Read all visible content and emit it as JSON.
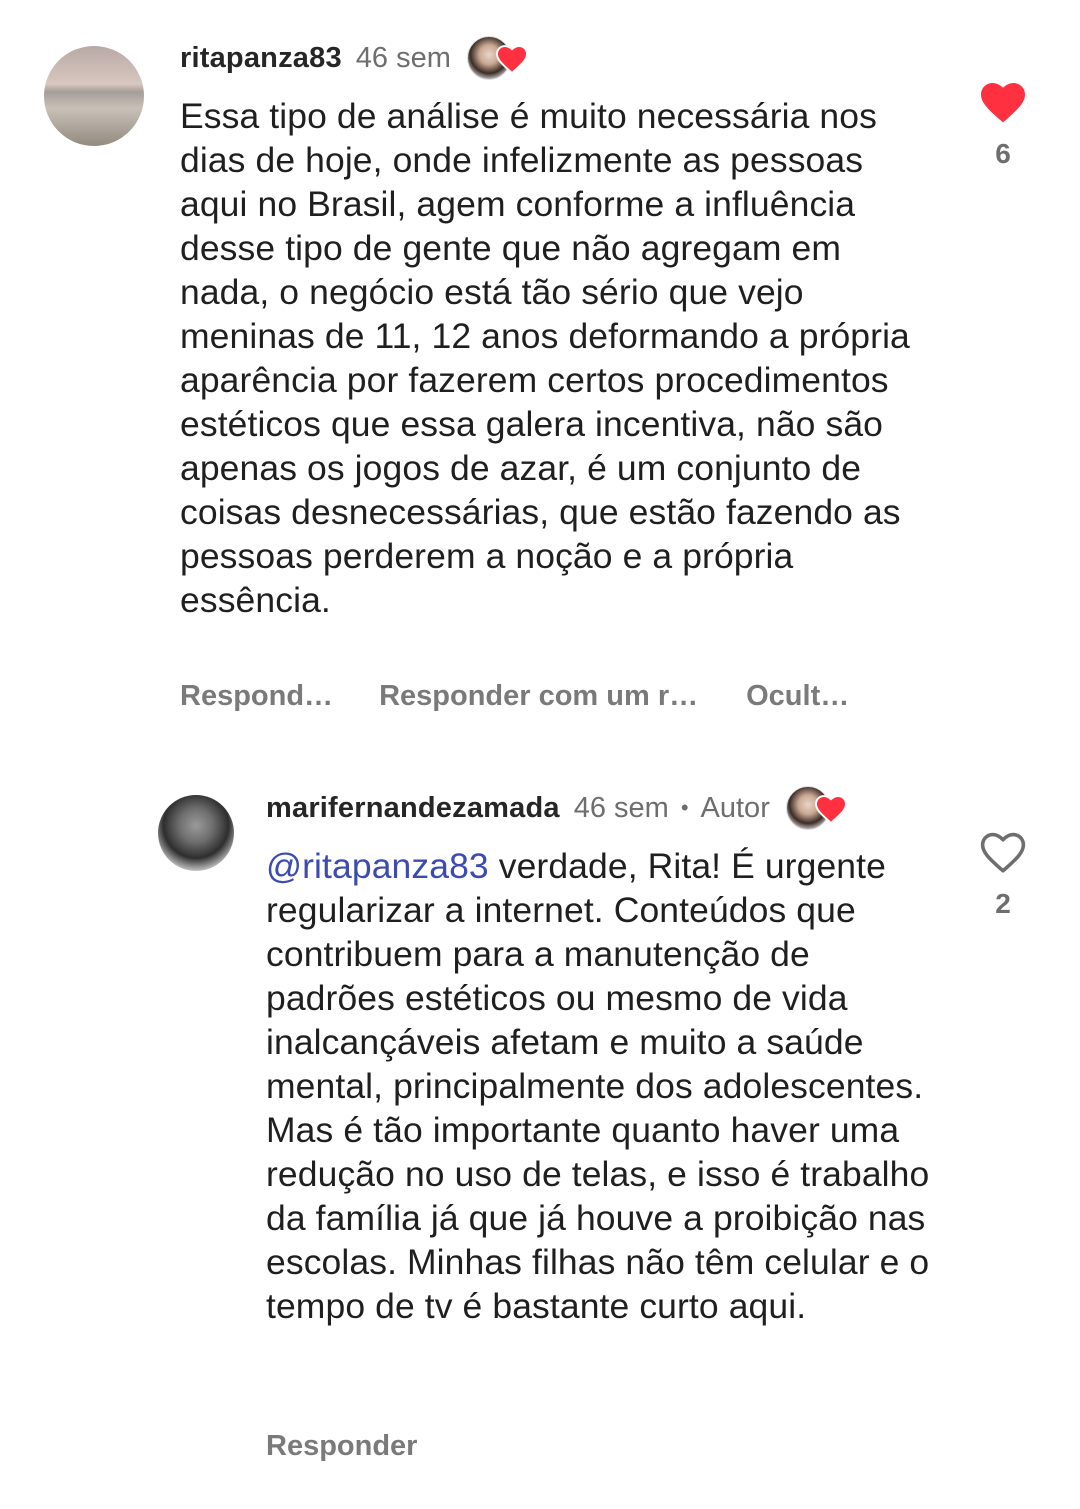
{
  "comments": [
    {
      "username": "ritapanza83",
      "time": "46 sem",
      "text": "Essa tipo de análise é muito necessária nos dias de hoje, onde infelizmente as pessoas aqui no Brasil, agem conforme a influência desse tipo de gente que não agregam em nada, o negócio está tão sério que vejo meninas de 11, 12 anos deformando a própria aparência por fazerem certos procedimentos estéticos que essa galera incentiva, não são apenas os jogos de azar, é um conjunto de coisas desnecessárias, que estão fazendo as pessoas perderem a noção e a própria essência.",
      "like_count": "6",
      "liked": true,
      "actions": {
        "reply": "Respond…",
        "reply_with": "Responder com um r…",
        "hide": "Ocult…"
      }
    },
    {
      "username": "marifernandezamada",
      "time": "46 sem",
      "separator": "•",
      "author_tag": "Autor",
      "mention": "@ritapanza83",
      "text": " verdade, Rita! É urgente regularizar a internet. Conteúdos que contribuem para a manutenção de padrões estéticos ou mesmo de vida inalcançáveis afetam e muito a saúde mental, principalmente dos adolescentes. Mas é tão importante quanto haver uma redução no uso de telas, e isso é trabalho da família já que já houve a proibição nas escolas. Minhas filhas não têm celular e o tempo de tv é bastante curto aqui.",
      "like_count": "2",
      "liked": false,
      "actions": {
        "reply": "Responder"
      }
    }
  ],
  "colors": {
    "heart_red": "#ff3040",
    "mention_blue": "#3b4bb0",
    "muted_text": "#6e6e6e"
  },
  "icons": {
    "liked": "heart-filled-icon",
    "not_liked": "heart-outline-icon",
    "creator_liked": "creator-liked-heart-icon"
  }
}
